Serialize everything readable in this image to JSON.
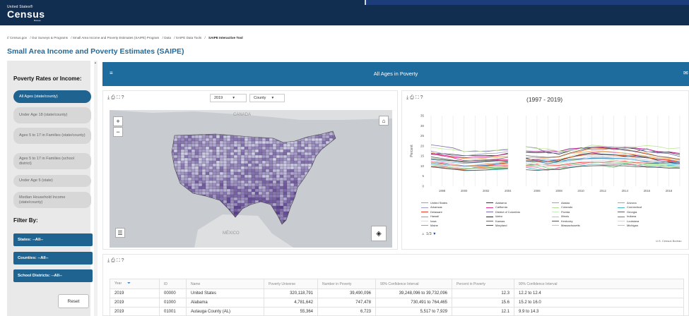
{
  "header": {
    "logo_small": "United States®",
    "logo_big": "Census",
    "logo_bureau": "Bureau"
  },
  "breadcrumb": [
    "//  Census.gov",
    "/  Our Surveys & Programs",
    "/  Small Area Income and Poverty Estimates (SAIPE) Program",
    "/  Data",
    "/  SAIPE Data Tools",
    "/"
  ],
  "breadcrumb_current": "SAIPE Interactive Tool",
  "page_title": "Small Area Income and Poverty Estimates (SAIPE)",
  "sidebar": {
    "heading": "Poverty Rates or Income:",
    "items": [
      {
        "label": "All Ages (state/county)",
        "active": true
      },
      {
        "label": "Under Age 18 (state/county)",
        "active": false
      },
      {
        "label": "Ages 5 to 17 in Families (state/county)",
        "active": false
      },
      {
        "label": "Ages 5 to 17 in Families (school district)",
        "active": false
      },
      {
        "label": "Under Age 5 (state)",
        "active": false
      },
      {
        "label": "Median Household Income (state/county)",
        "active": false
      }
    ],
    "filter_heading": "Filter By:",
    "filters": [
      "States: --All--",
      "Counties: --All--",
      "School Districts: --All--"
    ],
    "reset": "Reset"
  },
  "panel": {
    "title": "All Ages in Poverty"
  },
  "map": {
    "year": "2019",
    "level": "County",
    "label_canada": "CANADA",
    "label_mexico": "MÉXICO",
    "zoom_in": "+",
    "zoom_out": "−",
    "colors": {
      "water": "#c8ccd0",
      "low": "#d4d3ec",
      "high": "#5a3d8f"
    }
  },
  "chart_data": {
    "type": "line",
    "title": "(1997 - 2019)",
    "ylabel": "Percent",
    "ylim": [
      0,
      35
    ],
    "yticks": [
      0,
      5,
      10,
      15,
      20,
      25,
      30,
      35
    ],
    "xticks": [
      1998,
      2000,
      2002,
      2004,
      2006,
      2008,
      2010,
      2012,
      2014,
      2016,
      2018
    ],
    "x": [
      1997,
      1998,
      1999,
      2000,
      2001,
      2002,
      2003,
      2004,
      2005,
      2006,
      2007,
      2008,
      2009,
      2010,
      2011,
      2012,
      2013,
      2014,
      2015,
      2016,
      2017,
      2018,
      2019
    ],
    "gap_after": 2004,
    "series": [
      {
        "name": "United States",
        "color": "#6baed6",
        "values": [
          13.3,
          12.5,
          11.8,
          11.3,
          11.7,
          12.1,
          12.5,
          12.7,
          13.3,
          13.3,
          13.0,
          13.2,
          14.3,
          15.3,
          15.9,
          15.9,
          15.8,
          15.5,
          14.7,
          14.0,
          13.4,
          13.1,
          12.3
        ]
      },
      {
        "name": "Alabama",
        "color": "#333333",
        "values": [
          16.0,
          16.2,
          15.8,
          15.2,
          15.3,
          15.3,
          15.2,
          16.1,
          16.9,
          16.6,
          16.9,
          15.9,
          17.5,
          19.0,
          19.0,
          19.0,
          18.7,
          19.2,
          18.5,
          17.1,
          16.9,
          16.8,
          15.6
        ]
      },
      {
        "name": "Alaska",
        "color": "#74c476",
        "values": [
          10.0,
          9.9,
          8.8,
          8.4,
          8.7,
          8.8,
          9.0,
          9.1,
          10.2,
          10.6,
          8.9,
          8.5,
          9.5,
          9.9,
          10.1,
          10.1,
          9.3,
          11.2,
          10.3,
          11.1,
          11.1,
          10.9,
          10.8
        ]
      },
      {
        "name": "Arizona",
        "color": "#fd8d3c",
        "values": [
          17.0,
          15.0,
          14.4,
          13.8,
          13.5,
          14.0,
          14.6,
          14.8,
          14.2,
          14.2,
          14.2,
          14.7,
          16.5,
          17.4,
          19.0,
          18.7,
          18.6,
          18.2,
          17.4,
          16.4,
          14.9,
          14.0,
          13.5
        ]
      },
      {
        "name": "Arkansas",
        "color": "#9e9ac8",
        "values": [
          17.5,
          16.2,
          15.2,
          15.0,
          15.7,
          16.2,
          16.4,
          17.2,
          17.6,
          17.3,
          17.9,
          17.3,
          18.8,
          18.8,
          19.6,
          19.8,
          19.2,
          18.9,
          19.1,
          17.2,
          16.4,
          17.2,
          16.2
        ]
      },
      {
        "name": "California",
        "color": "#e7298a",
        "values": [
          15.9,
          15.2,
          14.1,
          12.7,
          12.6,
          12.8,
          13.1,
          13.2,
          13.3,
          13.1,
          12.4,
          13.3,
          14.2,
          15.8,
          16.6,
          17.0,
          16.8,
          16.4,
          15.3,
          14.4,
          13.3,
          12.8,
          11.8
        ]
      },
      {
        "name": "Colorado",
        "color": "#addd8e",
        "values": [
          10.0,
          9.5,
          9.1,
          8.6,
          9.1,
          9.7,
          10.0,
          10.3,
          11.1,
          12.0,
          12.0,
          11.4,
          12.9,
          13.4,
          13.5,
          13.7,
          13.0,
          12.0,
          11.5,
          10.3,
          10.3,
          9.6,
          9.3
        ]
      },
      {
        "name": "Connecticut",
        "color": "#41b6c4",
        "values": [
          9.6,
          9.2,
          8.5,
          7.7,
          7.8,
          8.0,
          8.3,
          8.5,
          9.3,
          8.3,
          7.9,
          9.3,
          9.4,
          10.1,
          10.9,
          10.7,
          10.7,
          10.8,
          10.5,
          9.8,
          9.6,
          10.4,
          10.0
        ]
      },
      {
        "name": "Delaware",
        "color": "#ef3b2c",
        "values": [
          9.6,
          9.8,
          9.0,
          8.8,
          8.8,
          9.1,
          9.4,
          9.7,
          10.4,
          11.1,
          10.5,
          10.4,
          11.2,
          11.8,
          11.9,
          11.9,
          12.4,
          12.5,
          11.7,
          11.5,
          11.3,
          12.5,
          11.3
        ]
      },
      {
        "name": "District of Columbia",
        "color": "#756bb1",
        "values": [
          20.5,
          19.8,
          19.0,
          17.2,
          17.5,
          17.2,
          17.8,
          18.1,
          19.6,
          18.9,
          16.4,
          16.5,
          17.7,
          18.8,
          18.2,
          18.2,
          18.9,
          17.7,
          17.3,
          18.6,
          16.6,
          16.2,
          14.7
        ]
      },
      {
        "name": "Florida",
        "color": "#c7e9c0",
        "values": [
          14.4,
          13.5,
          12.7,
          11.9,
          12.0,
          12.4,
          12.6,
          12.2,
          12.8,
          12.6,
          12.1,
          13.2,
          14.9,
          16.5,
          17.0,
          17.1,
          17.0,
          16.6,
          15.7,
          14.7,
          14.0,
          13.6,
          12.7
        ]
      },
      {
        "name": "Georgia",
        "color": "#636363",
        "values": [
          14.6,
          13.8,
          12.9,
          12.4,
          12.8,
          13.1,
          13.4,
          14.3,
          15.2,
          14.7,
          14.3,
          14.7,
          16.5,
          17.9,
          19.1,
          19.2,
          18.2,
          18.3,
          17.0,
          16.0,
          14.9,
          14.3,
          13.3
        ]
      },
      {
        "name": "Hawaii",
        "color": "#f768a1",
        "values": [
          12.4,
          11.8,
          10.9,
          10.2,
          10.2,
          10.4,
          10.3,
          10.4,
          9.8,
          9.3,
          8.0,
          9.1,
          10.4,
          10.7,
          12.0,
          11.6,
          11.2,
          11.4,
          10.6,
          9.3,
          9.5,
          9.0,
          9.3
        ]
      },
      {
        "name": "Idaho",
        "color": "#252525",
        "values": [
          13.6,
          13.1,
          12.6,
          11.9,
          11.9,
          12.4,
          12.7,
          12.5,
          13.9,
          12.6,
          12.1,
          12.6,
          14.3,
          15.7,
          16.5,
          15.9,
          15.5,
          14.8,
          15.1,
          14.4,
          12.8,
          11.8,
          11.2
        ]
      },
      {
        "name": "Illinois",
        "color": "#bcbddc",
        "values": [
          11.3,
          11.0,
          10.3,
          10.0,
          10.5,
          11.2,
          11.6,
          11.8,
          11.9,
          12.3,
          11.9,
          12.2,
          13.3,
          13.8,
          15.0,
          14.7,
          14.7,
          14.4,
          13.6,
          13.0,
          12.6,
          12.1,
          11.5
        ]
      },
      {
        "name": "Indiana",
        "color": "#e6550d",
        "values": [
          9.6,
          9.1,
          8.5,
          8.3,
          9.3,
          9.9,
          10.9,
          11.2,
          12.6,
          12.6,
          12.3,
          13.1,
          14.4,
          15.3,
          15.8,
          15.6,
          15.4,
          15.2,
          14.3,
          14.1,
          13.5,
          13.1,
          11.9
        ]
      },
      {
        "name": "Iowa",
        "color": "#dadaeb",
        "values": [
          10.1,
          9.6,
          8.9,
          8.7,
          8.8,
          9.3,
          9.5,
          9.9,
          11.3,
          10.9,
          10.8,
          11.3,
          11.9,
          12.4,
          12.6,
          12.7,
          12.5,
          12.2,
          12.1,
          12.0,
          11.8,
          11.1,
          11.2
        ]
      },
      {
        "name": "Kansas",
        "color": "#1f78b4",
        "values": [
          11.8,
          11.3,
          10.3,
          9.8,
          10.0,
          10.4,
          11.0,
          11.7,
          12.4,
          12.3,
          11.2,
          12.1,
          13.3,
          13.6,
          13.8,
          13.8,
          13.7,
          13.6,
          13.0,
          12.1,
          11.9,
          12.0,
          11.4
        ]
      },
      {
        "name": "Kentucky",
        "color": "#c51b8a",
        "values": [
          16.3,
          15.5,
          14.7,
          14.1,
          14.5,
          14.6,
          15.2,
          16.4,
          17.0,
          17.2,
          17.1,
          17.3,
          18.4,
          19.0,
          19.1,
          19.4,
          18.8,
          19.2,
          18.9,
          18.4,
          17.2,
          16.9,
          16.3
        ]
      },
      {
        "name": "Louisiana",
        "color": "#c2e699",
        "values": [
          19.3,
          18.6,
          18.1,
          17.3,
          17.1,
          17.6,
          17.9,
          18.7,
          19.5,
          18.7,
          18.6,
          17.3,
          17.5,
          18.7,
          20.4,
          19.9,
          19.7,
          19.8,
          19.6,
          20.2,
          19.7,
          18.6,
          19.0
        ]
      },
      {
        "name": "Maine",
        "color": "#6baed6",
        "values": [
          11.1,
          10.5,
          10.4,
          10.2,
          10.3,
          11.0,
          11.5,
          12.3,
          12.7,
          12.9,
          12.2,
          12.3,
          12.6,
          13.3,
          14.1,
          14.3,
          13.9,
          13.8,
          12.9,
          12.4,
          11.5,
          11.2,
          10.9
        ]
      },
      {
        "name": "Maryland",
        "color": "#525252",
        "values": [
          9.7,
          9.0,
          8.4,
          7.9,
          7.9,
          8.1,
          8.6,
          8.9,
          8.2,
          7.8,
          8.3,
          8.2,
          9.2,
          9.9,
          10.1,
          10.3,
          10.1,
          10.1,
          9.7,
          9.7,
          9.3,
          9.0,
          9.0
        ]
      },
      {
        "name": "Massachusetts",
        "color": "#a1d99b",
        "values": [
          10.5,
          10.0,
          9.5,
          8.9,
          9.0,
          9.3,
          9.6,
          9.8,
          10.3,
          9.9,
          9.9,
          10.0,
          10.8,
          11.3,
          11.6,
          11.9,
          11.9,
          11.6,
          11.5,
          10.4,
          10.5,
          10.0,
          9.4
        ]
      },
      {
        "name": "Michigan",
        "color": "#fdae6b",
        "values": [
          11.9,
          11.0,
          10.4,
          9.9,
          10.4,
          11.0,
          11.4,
          12.0,
          13.2,
          13.5,
          14.0,
          14.4,
          16.2,
          16.8,
          17.5,
          17.4,
          17.0,
          16.2,
          15.8,
          15.0,
          14.2,
          13.7,
          13.0
        ]
      }
    ],
    "pager": "1/3"
  },
  "credit": "U.S. Census Bureau",
  "table": {
    "headers": [
      "Year",
      "ID",
      "Name",
      "Poverty Universe",
      "Number in Poverty",
      "90% Confidence Interval",
      "Percent in Poverty",
      "90% Confidence Interval"
    ],
    "rows": [
      [
        "2019",
        "00000",
        "United States",
        "320,118,791",
        "39,490,096",
        "39,248,096 to 39,732,096",
        "12.3",
        "12.2 to 12.4"
      ],
      [
        "2019",
        "01000",
        "Alabama",
        "4,781,642",
        "747,478",
        "730,491 to 764,465",
        "15.6",
        "15.2 to 16.0"
      ],
      [
        "2019",
        "01001",
        "Autauga County (AL)",
        "55,364",
        "6,723",
        "5,517 to 7,929",
        "12.1",
        "9.9 to 14.3"
      ]
    ]
  }
}
